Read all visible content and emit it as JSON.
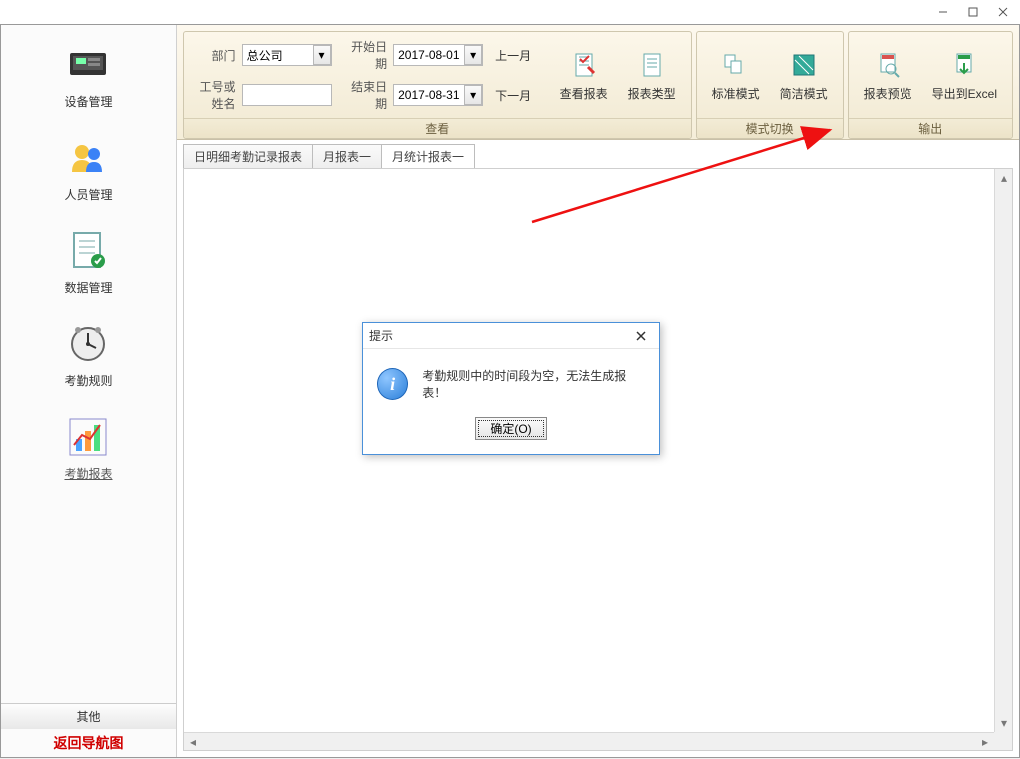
{
  "titlebar": {
    "min": "—",
    "max": "☐",
    "close": "✕"
  },
  "sidebar": {
    "items": [
      {
        "label": "设备管理"
      },
      {
        "label": "人员管理"
      },
      {
        "label": "数据管理"
      },
      {
        "label": "考勤规则"
      },
      {
        "label": "考勤报表"
      }
    ],
    "other": "其他",
    "return": "返回导航图"
  },
  "ribbon": {
    "view": {
      "dept_label": "部门",
      "dept_value": "总公司",
      "emp_label": "工号或姓名",
      "emp_value": "",
      "start_label": "开始日期",
      "start_value": "2017-08-01",
      "end_label": "结束日期",
      "end_value": "2017-08-31",
      "prev_month": "上一月",
      "next_month": "下一月",
      "view_report": "查看报表",
      "report_type": "报表类型",
      "title": "查看"
    },
    "mode": {
      "standard": "标准模式",
      "simple": "简洁模式",
      "title": "模式切换"
    },
    "output": {
      "preview": "报表预览",
      "export": "导出到Excel",
      "title": "输出"
    }
  },
  "tabs": [
    {
      "label": "日明细考勤记录报表"
    },
    {
      "label": "月报表一"
    },
    {
      "label": "月统计报表一"
    }
  ],
  "dialog": {
    "title": "提示",
    "message": "考勤规则中的时间段为空，无法生成报表！",
    "ok": "确定(O)"
  }
}
